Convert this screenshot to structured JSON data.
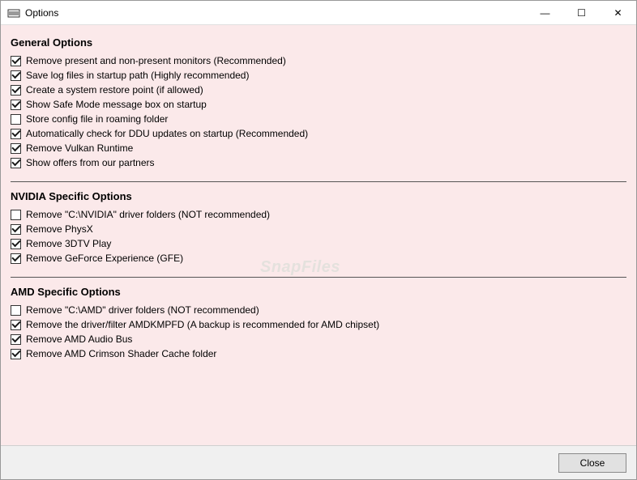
{
  "window": {
    "title": "Options",
    "minimize_glyph": "—",
    "maximize_glyph": "☐",
    "close_glyph": "✕"
  },
  "sections": {
    "general": {
      "title": "General Options",
      "options": [
        {
          "label": "Remove present and non-present monitors (Recommended)",
          "checked": true
        },
        {
          "label": "Save log files in startup path (Highly recommended)",
          "checked": true
        },
        {
          "label": "Create a system restore point (if allowed)",
          "checked": true
        },
        {
          "label": "Show Safe Mode message box on startup",
          "checked": true
        },
        {
          "label": "Store config file in roaming folder",
          "checked": false
        },
        {
          "label": "Automatically check for DDU updates on startup (Recommended)",
          "checked": true
        },
        {
          "label": "Remove Vulkan Runtime",
          "checked": true
        },
        {
          "label": "Show offers from our partners",
          "checked": true
        }
      ]
    },
    "nvidia": {
      "title": "NVIDIA Specific Options",
      "options": [
        {
          "label": "Remove \"C:\\NVIDIA\" driver folders (NOT recommended)",
          "checked": false
        },
        {
          "label": "Remove PhysX",
          "checked": true
        },
        {
          "label": "Remove 3DTV Play",
          "checked": true
        },
        {
          "label": "Remove GeForce Experience (GFE)",
          "checked": true
        }
      ]
    },
    "amd": {
      "title": "AMD Specific Options",
      "options": [
        {
          "label": "Remove \"C:\\AMD\" driver folders (NOT recommended)",
          "checked": false
        },
        {
          "label": "Remove the driver/filter AMDKMPFD (A backup is recommended for AMD chipset)",
          "checked": true
        },
        {
          "label": "Remove AMD Audio Bus",
          "checked": true
        },
        {
          "label": "Remove AMD Crimson Shader Cache folder",
          "checked": true
        }
      ]
    }
  },
  "footer": {
    "close_label": "Close"
  },
  "watermark": "SnapFiles"
}
